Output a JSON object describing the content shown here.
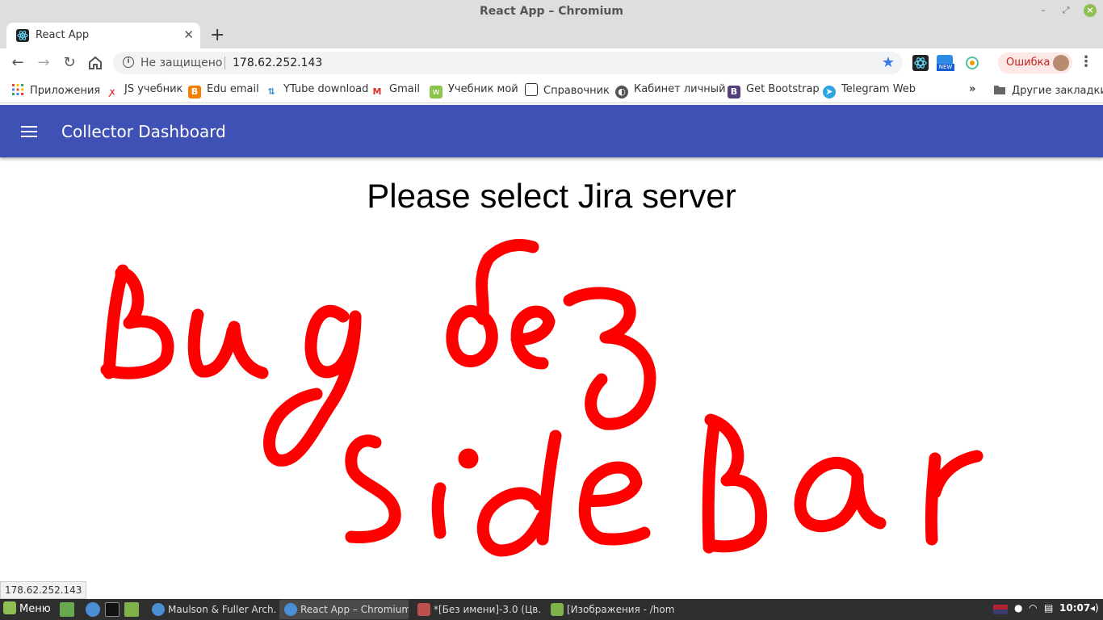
{
  "window": {
    "title": "React App – Chromium"
  },
  "tab": {
    "title": "React App"
  },
  "omnibox": {
    "security": "Не защищено",
    "url": "178.62.252.143"
  },
  "extensions": {
    "new_badge": "NEW"
  },
  "profile": {
    "label": "Ошибка"
  },
  "bookmarks": {
    "items": [
      {
        "label": "Приложения",
        "icon": "apps-grid-icon"
      },
      {
        "label": "JS учебник",
        "icon": "js-icon"
      },
      {
        "label": "Edu email",
        "icon": "blogger-icon"
      },
      {
        "label": "YTube download",
        "icon": "download-icon"
      },
      {
        "label": "Gmail",
        "icon": "gmail-icon"
      },
      {
        "label": "Учебник мой",
        "icon": "book-icon"
      },
      {
        "label": "Справочник",
        "icon": "comment-icon"
      },
      {
        "label": "Кабинет личный",
        "icon": "globe-icon"
      },
      {
        "label": "Get Bootstrap",
        "icon": "bootstrap-icon"
      },
      {
        "label": "Telegram Web",
        "icon": "telegram-icon"
      }
    ],
    "more": "»",
    "other": "Другие закладки"
  },
  "appbar": {
    "title": "Collector Dashboard"
  },
  "main": {
    "heading": "Please select Jira server",
    "scribble": "Bug без SideBar"
  },
  "status_url": "178.62.252.143",
  "taskbar": {
    "menu_label": "Меню",
    "tasks": [
      {
        "label": "Maulson & Fuller Arch...",
        "icon": "chromium-icon"
      },
      {
        "label": "React App – Chromium",
        "icon": "chromium-icon"
      },
      {
        "label": "*[Без имени]-3.0 (Цв...",
        "icon": "gimp-icon"
      },
      {
        "label": "[Изображения - /hom...",
        "icon": "folder-icon"
      }
    ],
    "clock": "10:07"
  },
  "colors": {
    "appbar": "#3f51b5",
    "scribble": "#ff0000",
    "taskbar": "#2f2f2f",
    "accent": "#3b78e7"
  }
}
